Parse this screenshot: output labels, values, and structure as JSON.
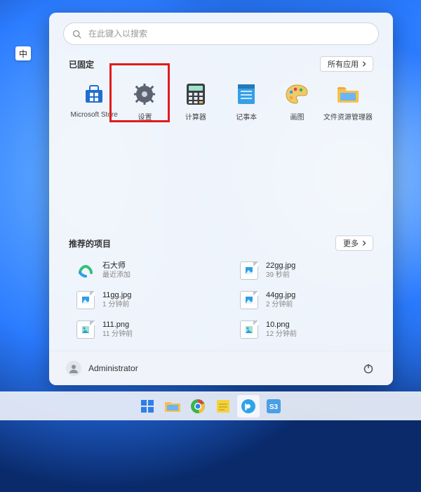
{
  "ime_badge": "中",
  "search": {
    "placeholder": "在此键入以搜索"
  },
  "pinned": {
    "title": "已固定",
    "all_apps_label": "所有应用",
    "apps": [
      {
        "id": "msstore",
        "label": "Microsoft Store"
      },
      {
        "id": "settings",
        "label": "设置"
      },
      {
        "id": "calc",
        "label": "计算器"
      },
      {
        "id": "notepad",
        "label": "记事本"
      },
      {
        "id": "paint",
        "label": "画图"
      },
      {
        "id": "explorer",
        "label": "文件资源管理器"
      }
    ]
  },
  "recommended": {
    "title": "推荐的项目",
    "more_label": "更多",
    "items": [
      {
        "id": "app-shidashi",
        "name": "石大师",
        "sub": "最近添加",
        "kind": "app"
      },
      {
        "id": "22gg",
        "name": "22gg.jpg",
        "sub": "39 秒前",
        "kind": "jpg"
      },
      {
        "id": "11gg",
        "name": "11gg.jpg",
        "sub": "1 分钟前",
        "kind": "jpg"
      },
      {
        "id": "44gg",
        "name": "44gg.jpg",
        "sub": "2 分钟前",
        "kind": "jpg"
      },
      {
        "id": "111",
        "name": "111.png",
        "sub": "11 分钟前",
        "kind": "png"
      },
      {
        "id": "10",
        "name": "10.png",
        "sub": "12 分钟前",
        "kind": "png"
      }
    ]
  },
  "user": {
    "name": "Administrator"
  },
  "taskbar": {
    "items": [
      {
        "id": "start",
        "name": "start-button"
      },
      {
        "id": "explorer",
        "name": "explorer-button"
      },
      {
        "id": "chrome",
        "name": "chrome-button"
      },
      {
        "id": "notes",
        "name": "notes-button"
      },
      {
        "id": "browser2",
        "name": "browser2-button"
      },
      {
        "id": "s3",
        "name": "s3-button"
      }
    ]
  },
  "highlight": {
    "target_app": "settings"
  }
}
